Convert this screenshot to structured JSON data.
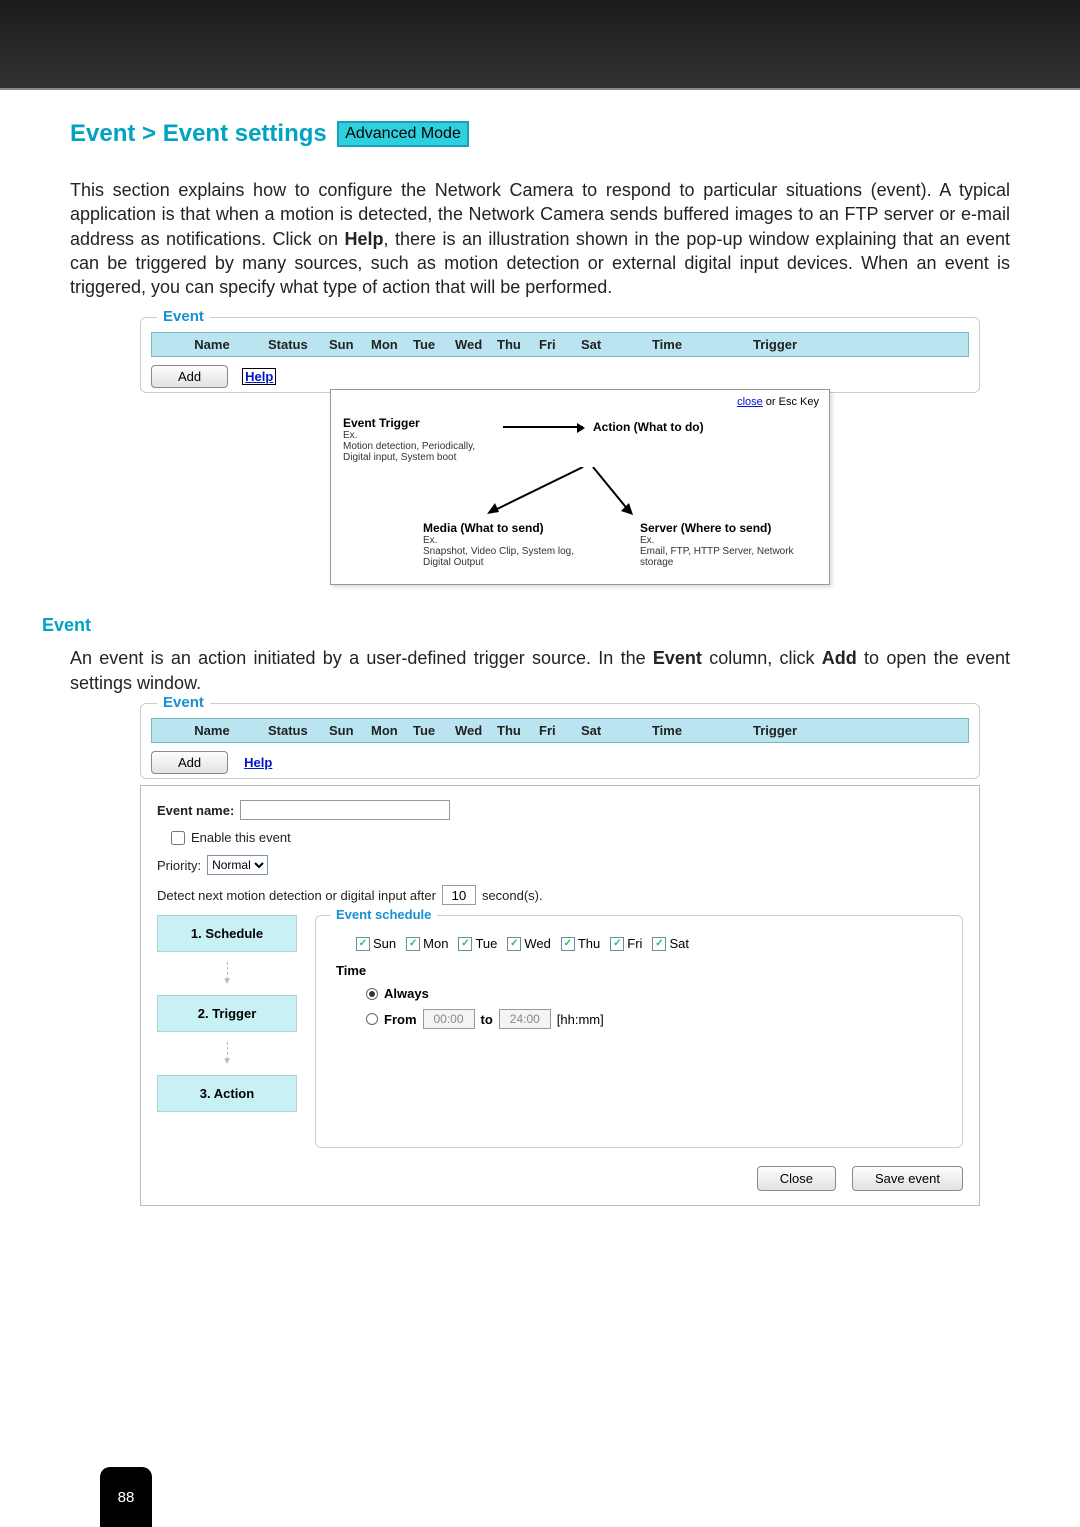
{
  "title": {
    "breadcrumb": "Event > Event settings",
    "mode": "Advanced Mode"
  },
  "intro": {
    "p1_a": "This section explains how to configure the Network Camera to respond to particular situations (event). A typical application is that when a motion is detected, the Network Camera sends buffered images to an FTP server or e-mail address as notifications. Click on ",
    "p1_help": "Help",
    "p1_b": ", there is an illustration shown in the pop-up window explaining that an event can be triggered by many sources, such as motion detection or external digital input devices. When an event is triggered, you can specify what type of action that will be performed."
  },
  "event_panel": {
    "legend": "Event",
    "cols": {
      "name": "Name",
      "status": "Status",
      "sun": "Sun",
      "mon": "Mon",
      "tue": "Tue",
      "wed": "Wed",
      "thu": "Thu",
      "fri": "Fri",
      "sat": "Sat",
      "time": "Time",
      "trigger": "Trigger"
    },
    "add": "Add",
    "help": "Help"
  },
  "popup": {
    "close_link": "close",
    "close_suffix": " or Esc Key",
    "trigger_hdr": "Event Trigger",
    "trigger_ex_label": "Ex.",
    "trigger_ex": "Motion detection, Periodically, Digital input, System boot",
    "action_hdr": "Action (What to do)",
    "media_hdr": "Media (What to send)",
    "media_ex_label": "Ex.",
    "media_ex": "Snapshot, Video Clip, System log, Digital Output",
    "server_hdr": "Server (Where to send)",
    "server_ex_label": "Ex.",
    "server_ex": "Email, FTP, HTTP Server, Network storage"
  },
  "section_event_h": "Event",
  "section_event_body_a": "An event is an action initiated by a user-defined trigger source. In the ",
  "section_event_body_b": "Event",
  "section_event_body_c": " column, click ",
  "section_event_body_d": "Add",
  "section_event_body_e": " to open the event settings window.",
  "settings": {
    "event_name_label": "Event name:",
    "enable_label": "Enable this event",
    "priority_label": "Priority:",
    "priority_value": "Normal",
    "detect_a": "Detect next motion detection or digital input after",
    "detect_secs": "10",
    "detect_b": "second(s).",
    "steps": {
      "s1": "1.  Schedule",
      "s2": "2.  Trigger",
      "s3": "3.  Action"
    },
    "sched_legend": "Event schedule",
    "days": {
      "sun": "Sun",
      "mon": "Mon",
      "tue": "Tue",
      "wed": "Wed",
      "thu": "Thu",
      "fri": "Fri",
      "sat": "Sat"
    },
    "time_label": "Time",
    "always": "Always",
    "from": "From",
    "from_v": "00:00",
    "to": "to",
    "to_v": "24:00",
    "hhmm": "[hh:mm]",
    "btn_close": "Close",
    "btn_save": "Save event"
  },
  "page_number": "88"
}
